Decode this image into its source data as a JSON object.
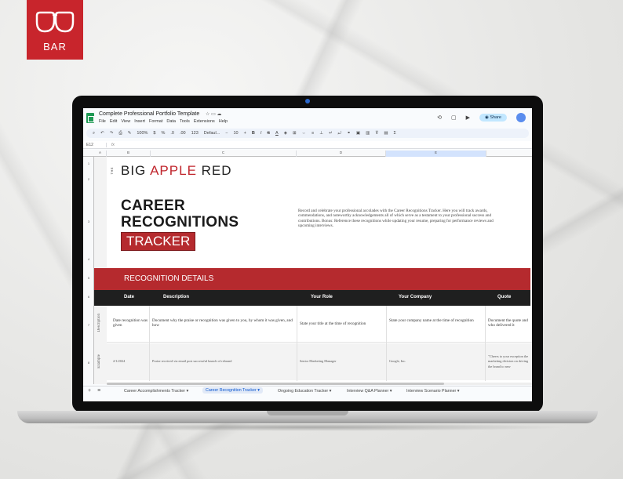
{
  "logo": {
    "text": "BAR"
  },
  "sheet": {
    "doc_title": "Complete Professional Portfolio Template",
    "menu": [
      "File",
      "Edit",
      "View",
      "Insert",
      "Format",
      "Data",
      "Tools",
      "Extensions",
      "Help"
    ],
    "share_label": "Share",
    "toolbar": {
      "zoom": "100%",
      "currency": "$",
      "percent": "%",
      "dec_down": ".0",
      "dec_up": ".00",
      "number_format": "123",
      "font": "Defaul...",
      "font_size": "10",
      "bold": "B",
      "italic": "I",
      "strike": "S",
      "text_color": "A"
    },
    "cell_ref": "E12",
    "fx_label": "fx",
    "columns": [
      "A",
      "B",
      "C",
      "D",
      "E"
    ],
    "rows": [
      "1",
      "2",
      "3",
      "4",
      "5",
      "6",
      "7",
      "8"
    ]
  },
  "brand": {
    "the": "THE",
    "big": "BIG",
    "apple": "APPLE",
    "red": "RED"
  },
  "page": {
    "title_line1": "CAREER",
    "title_line2": "RECOGNITIONS",
    "tracker": "TRACKER",
    "intro": "Record and celebrate your professional accolades with the Career Recognitions Tracker. Here you will track awards, commendations, and noteworthy acknowledgements all of which serve as a testament to your professional success and contributions. Bonus: Reference these recognitions while updating your resume, preparing for performance reviews and upcoming interviews.",
    "section_title": "RECOGNITION DETAILS"
  },
  "table": {
    "headers": [
      "Date",
      "Description",
      "Your Role",
      "Your Company",
      "Quote"
    ],
    "row_labels": [
      "Description",
      "Example"
    ],
    "description_row": [
      "Date recognition was given",
      "Document why the praise or recognition was given to you, by whom it was given, and how",
      "State your title at the time of recognition",
      "State your company name at the time of recognition",
      "Document the quote and who delivered it"
    ],
    "example_row": [
      "2/1/2024",
      "Praise received via email post successful launch of rebrand",
      "Senior Marketing Manager",
      "Google, Inc.",
      "\"Cheers to your exception the marketing division on driving the brand to new"
    ]
  },
  "tabs": {
    "items": [
      "Career Accomplishments Tracker",
      "Career Recognition Tracker",
      "Ongoing Education Tracker",
      "Interview Q&A Planner",
      "Interview Scenario Planner"
    ],
    "active_index": 1,
    "add_label": "+",
    "list_label": "≡"
  },
  "colors": {
    "brand_red": "#b52a2e",
    "header_dark": "#1f1f1f",
    "sheets_green": "#1f9a55",
    "share_blue": "#c2e7ff"
  },
  "icons": [
    "glasses-logo-icon",
    "star-icon",
    "folder-icon",
    "cloud-icon",
    "history-icon",
    "video-icon",
    "globe-icon"
  ]
}
